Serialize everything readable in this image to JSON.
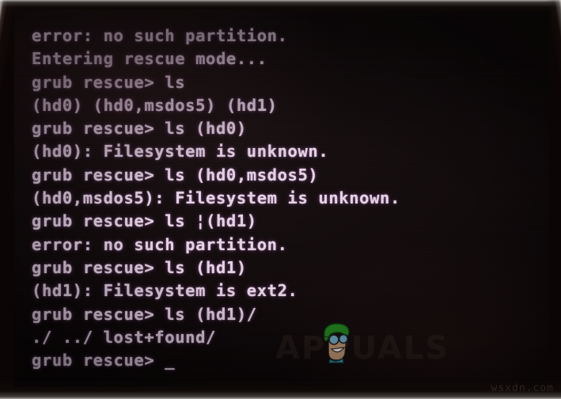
{
  "screen": {
    "type": "grub-rescue-console",
    "colors": {
      "background": "#0a0506",
      "text": "#ead6ea",
      "glow": "#c88cd2"
    },
    "lines": [
      "error: no such partition.",
      "Entering rescue mode...",
      "grub rescue> ls",
      "(hd0) (hd0,msdos5) (hd1)",
      "grub rescue> ls (hd0)",
      "(hd0): Filesystem is unknown.",
      "grub rescue> ls (hd0,msdos5)",
      "(hd0,msdos5): Filesystem is unknown.",
      "grub rescue> ls ¦(hd1)",
      "error: no such partition.",
      "grub rescue> ls (hd1)",
      "(hd1): Filesystem is ext2.",
      "grub rescue> ls (hd1)/",
      "./ ../ lost+found/"
    ],
    "prompt": "grub rescue> ",
    "cursor": "_"
  },
  "watermark": {
    "brand": "APPUALS",
    "site_stamp": "wsxdn.com"
  }
}
